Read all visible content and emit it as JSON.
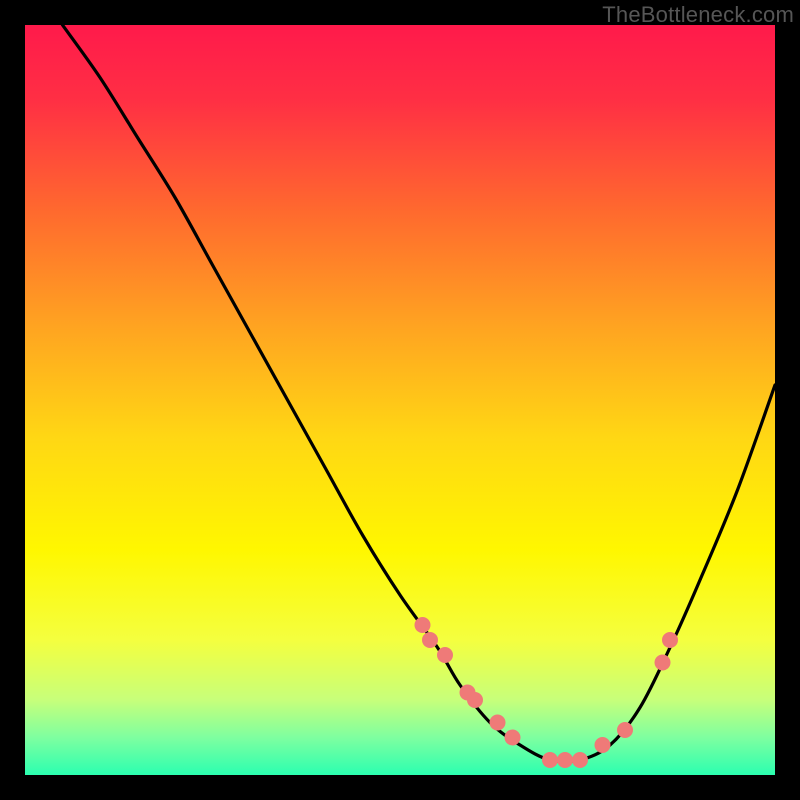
{
  "watermark": "TheBottleneck.com",
  "chart_data": {
    "type": "line",
    "title": "",
    "xlabel": "",
    "ylabel": "",
    "xlim": [
      0,
      100
    ],
    "ylim": [
      0,
      100
    ],
    "grid": false,
    "legend": false,
    "annotations": [],
    "gradient_stops": [
      {
        "offset": 0.0,
        "color": "#ff1a4b"
      },
      {
        "offset": 0.1,
        "color": "#ff2f44"
      },
      {
        "offset": 0.25,
        "color": "#ff6a2e"
      },
      {
        "offset": 0.4,
        "color": "#ffa321"
      },
      {
        "offset": 0.55,
        "color": "#ffd714"
      },
      {
        "offset": 0.7,
        "color": "#fff700"
      },
      {
        "offset": 0.82,
        "color": "#f4ff3f"
      },
      {
        "offset": 0.9,
        "color": "#c7ff7a"
      },
      {
        "offset": 0.95,
        "color": "#7effa0"
      },
      {
        "offset": 1.0,
        "color": "#2bffb0"
      }
    ],
    "series": [
      {
        "name": "bottleneck-curve",
        "x": [
          5,
          10,
          15,
          20,
          25,
          30,
          35,
          40,
          45,
          50,
          55,
          58,
          62,
          66,
          70,
          74,
          78,
          82,
          86,
          90,
          95,
          100
        ],
        "y": [
          100,
          93,
          85,
          77,
          68,
          59,
          50,
          41,
          32,
          24,
          17,
          12,
          7,
          4,
          2,
          2,
          4,
          9,
          17,
          26,
          38,
          52
        ]
      }
    ],
    "markers": {
      "name": "highlight-points",
      "x": [
        53,
        54,
        56,
        59,
        60,
        63,
        65,
        70,
        72,
        74,
        77,
        80,
        85,
        86
      ],
      "y": [
        20,
        18,
        16,
        11,
        10,
        7,
        5,
        2,
        2,
        2,
        4,
        6,
        15,
        18
      ]
    }
  }
}
